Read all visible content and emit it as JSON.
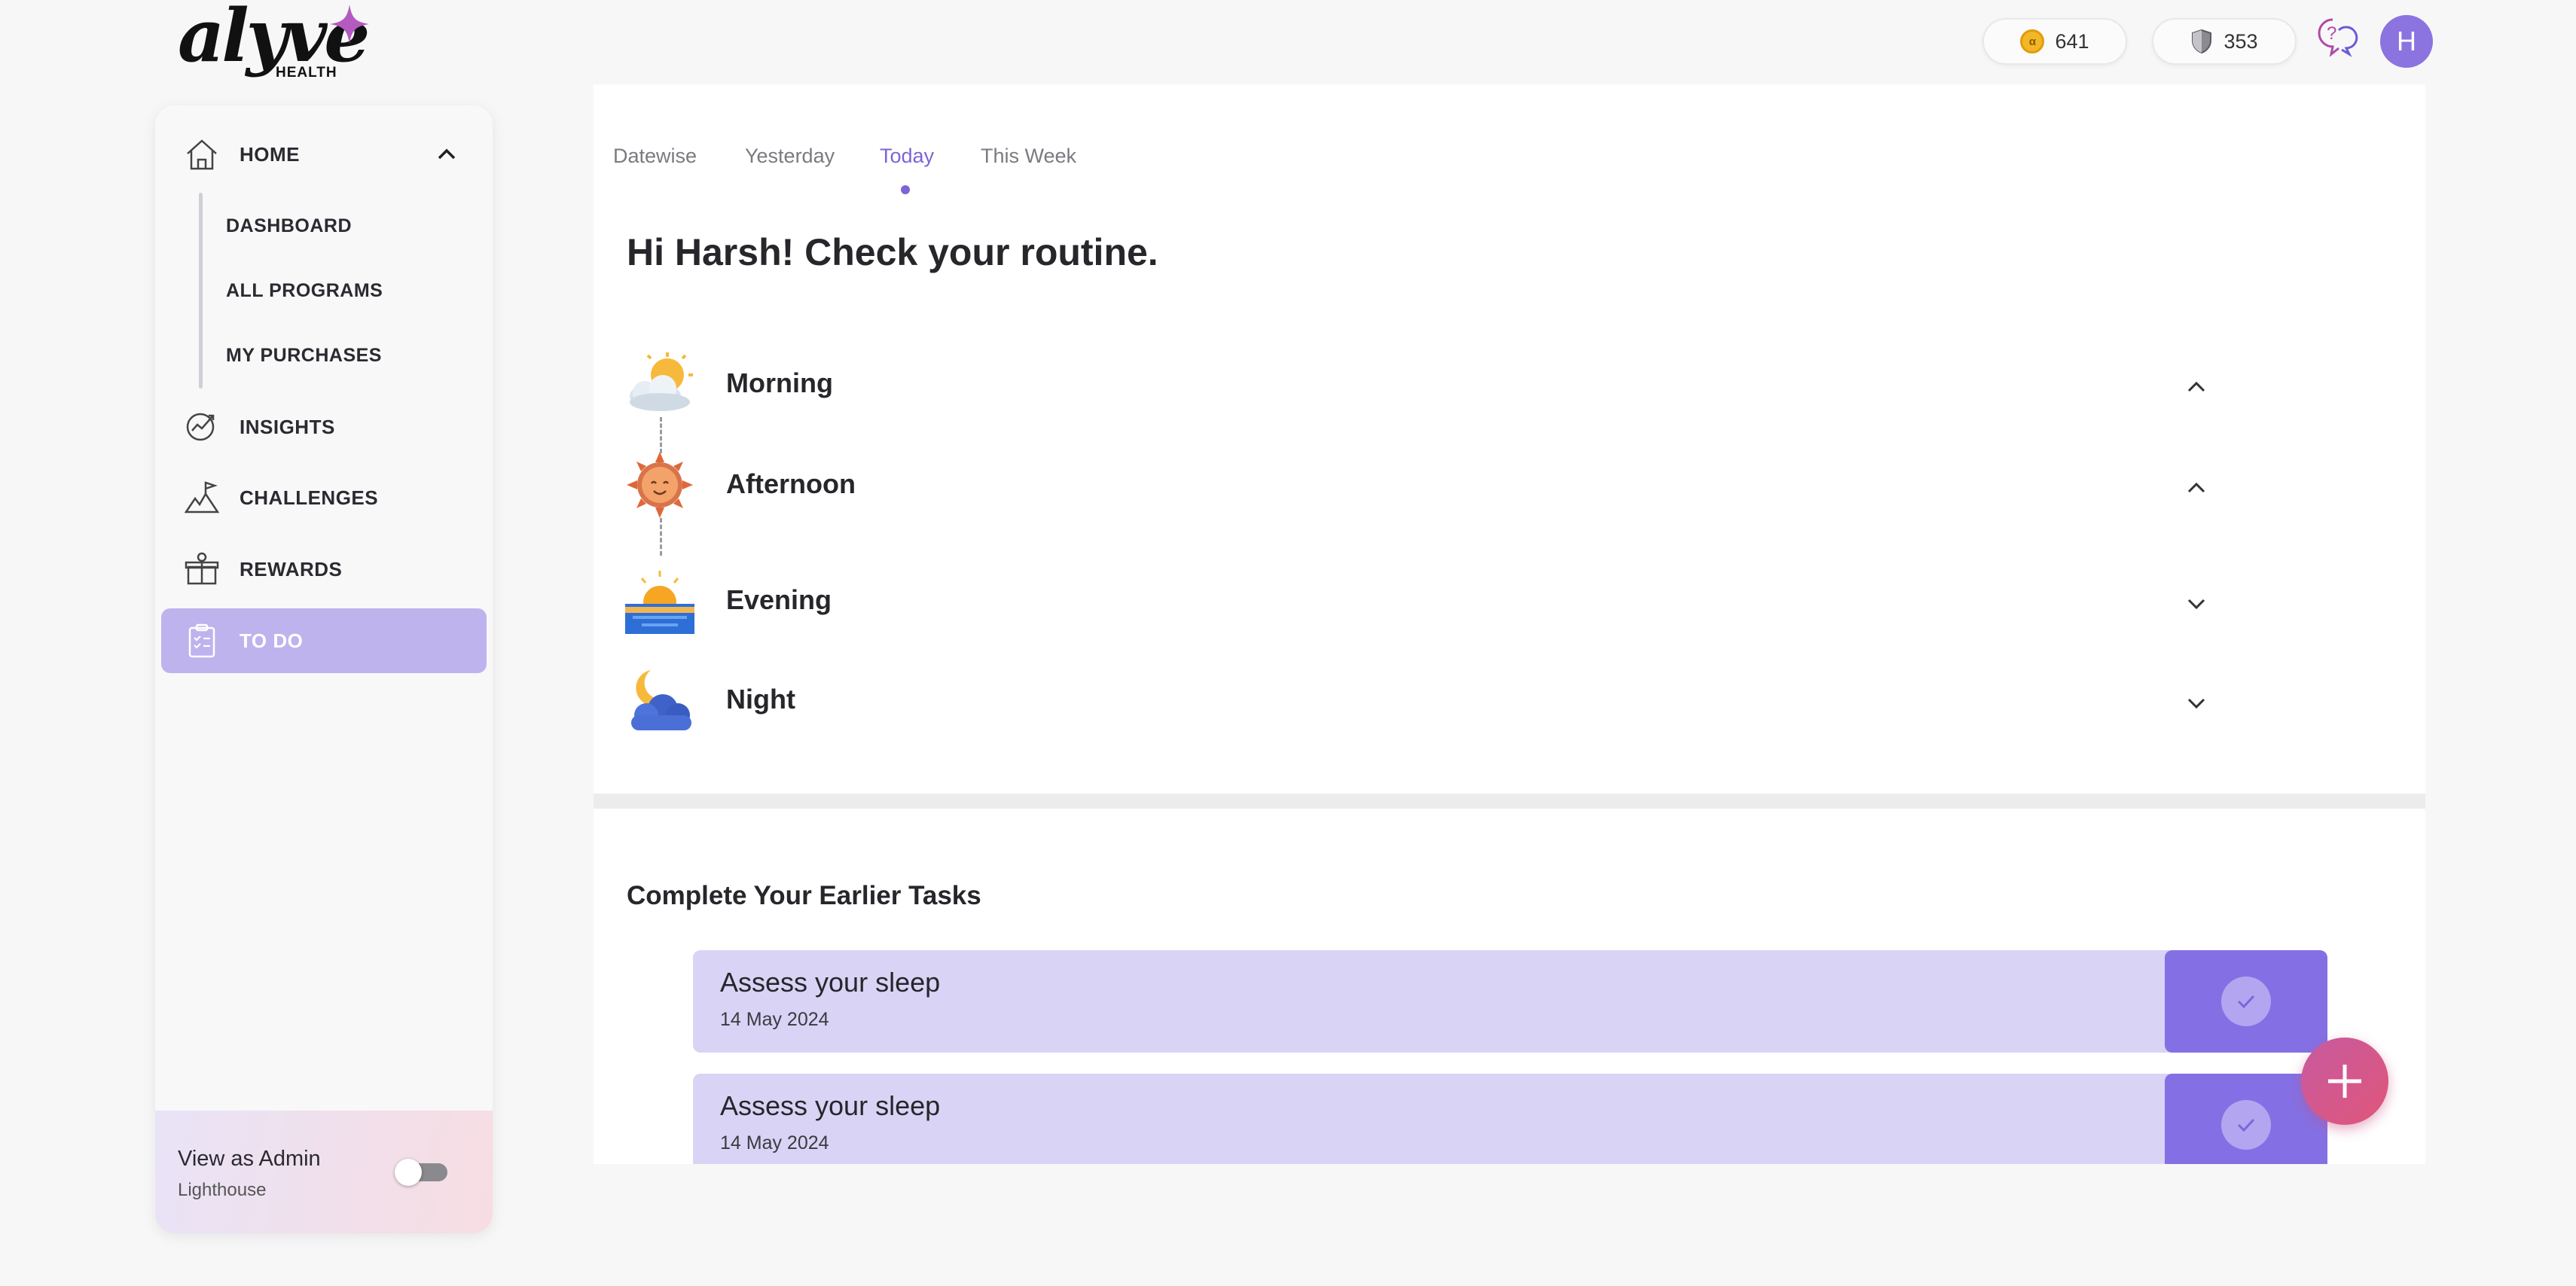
{
  "brand": {
    "logo_word": "alyve",
    "logo_sub": "HEALTH"
  },
  "topbar": {
    "coin_icon": "coin-icon",
    "coins": "641",
    "shield_icon": "shield-icon",
    "shields": "353",
    "help_icon": "help-chat-icon",
    "avatar_initial": "H"
  },
  "sidebar": {
    "home": {
      "label": "HOME",
      "icon": "home-icon"
    },
    "sub_items": [
      "DASHBOARD",
      "ALL PROGRAMS",
      "MY PURCHASES"
    ],
    "insights": {
      "label": "INSIGHTS",
      "icon": "insights-icon"
    },
    "challenges": {
      "label": "CHALLENGES",
      "icon": "challenges-flag-icon"
    },
    "rewards": {
      "label": "REWARDS",
      "icon": "gift-icon"
    },
    "todo": {
      "label": "TO DO",
      "icon": "clipboard-icon"
    },
    "admin": {
      "title": "View as Admin",
      "subtitle": "Lighthouse",
      "toggle_on": false
    }
  },
  "tabs": [
    "Datewise",
    "Yesterday",
    "Today",
    "This Week"
  ],
  "active_tab": "Today",
  "greeting": "Hi Harsh! Check your routine.",
  "routines": [
    {
      "name": "Morning",
      "icon": "sun-behind-cloud-icon",
      "expanded": true
    },
    {
      "name": "Afternoon",
      "icon": "sun-face-icon",
      "expanded": true
    },
    {
      "name": "Evening",
      "icon": "sunset-icon",
      "expanded": false
    },
    {
      "name": "Night",
      "icon": "moon-cloud-icon",
      "expanded": false
    }
  ],
  "earlier": {
    "title": "Complete Your Earlier Tasks",
    "tasks": [
      {
        "name": "Assess your sleep",
        "date": "14 May 2024"
      },
      {
        "name": "Assess your sleep",
        "date": "14 May 2024"
      }
    ]
  },
  "colors": {
    "accent": "#7e63d6",
    "active_nav": "#bfb3ee",
    "task_bg": "#d9d3f5",
    "task_done": "#8470e4",
    "fab": "#d9568a"
  }
}
